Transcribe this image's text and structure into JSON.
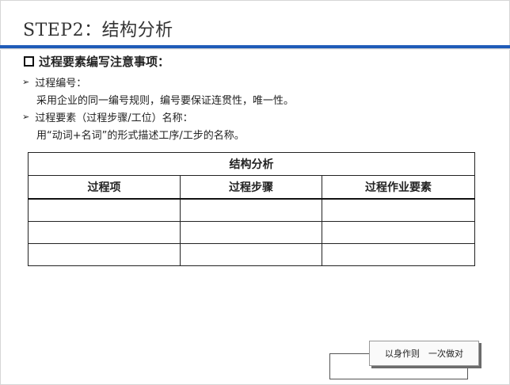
{
  "title": "STEP2：结构分析",
  "heading": "过程要素编写注意事项：",
  "bullets": [
    {
      "label": "过程编号：",
      "detail": "采用企业的同一编号规则，编号要保证连贯性，唯一性。"
    },
    {
      "label": "过程要素（过程步骤/工位）名称：",
      "detail": "用“动词+名词”的形式描述工序/工步的名称。"
    }
  ],
  "table": {
    "caption": "结构分析",
    "columns": [
      "过程项",
      "过程步骤",
      "过程作业要素"
    ]
  },
  "stamp": "以身作则　一次做对",
  "colors": {
    "accent": "#1f5bb8"
  }
}
